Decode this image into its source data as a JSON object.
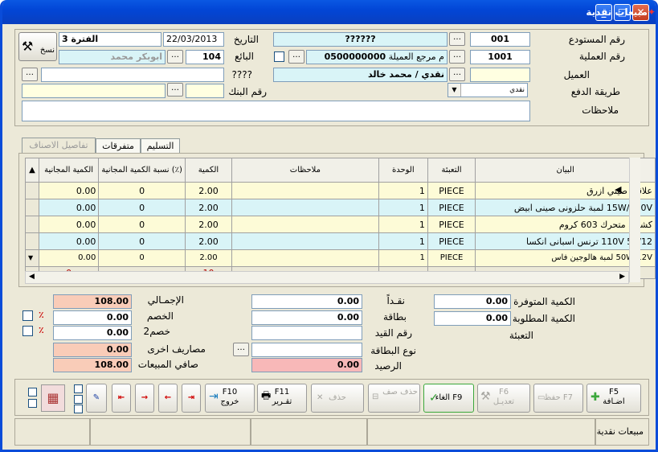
{
  "window": {
    "title": "مبيعات نقدية"
  },
  "header": {
    "labels": {
      "warehouse_no": "رقم المستودع",
      "operation_no": "رقم العملية",
      "client": "العميل",
      "payment_method": "طريقة الدفع",
      "notes": "ملاحظات",
      "date": "التاريخ",
      "seller": "البائع",
      "unknown": "????",
      "bank_no": "رقم البنك"
    },
    "values": {
      "warehouse_no": "001",
      "warehouse_name": "??????",
      "operation_no": "1001",
      "client_ref": "0500000000",
      "client_ref_label": "م مرجع العميلة",
      "client_name": "نقدي / محمد خالد",
      "payment_method": "نقدي",
      "date": "22/03/2013",
      "period": "الفترة 3",
      "seller_no": "104",
      "seller_name": "ابوبكر محمد",
      "copy_button": "نسخ"
    }
  },
  "tabs": [
    "تفاصيل الاصناف",
    "متفرقات",
    "التسليم"
  ],
  "grid": {
    "columns": [
      "البيان",
      "التعبئة",
      "الوحدة",
      "ملاحظات",
      "الكمية",
      "نسبة الكمية المجانية (٪)",
      "الكمية المجانية"
    ],
    "rows": [
      {
        "desc": "علاقي صيني ازرق",
        "pack": "PIECE",
        "unit": "1",
        "notes": "",
        "qty": "2.00",
        "free_pct": "0",
        "free_qty": "0.00"
      },
      {
        "desc": "15W/220V لمبة حلزونى صينى ابيض",
        "pack": "PIECE",
        "unit": "1",
        "notes": "",
        "qty": "2.00",
        "free_pct": "0",
        "free_qty": "0.00"
      },
      {
        "desc": "كشاف متحرك 603 كروم",
        "pack": "PIECE",
        "unit": "1",
        "notes": "",
        "qty": "2.00",
        "free_pct": "0",
        "free_qty": "0.00"
      },
      {
        "desc": "50/12  110V  ترنس اسبانى انكسا",
        "pack": "PIECE",
        "unit": "1",
        "notes": "",
        "qty": "2.00",
        "free_pct": "0",
        "free_qty": "0.00"
      },
      {
        "desc": "50W/12V  لمبة هالوجين فاس",
        "pack": "PIECE",
        "unit": "1",
        "notes": "",
        "qty": "2.00",
        "free_pct": "0",
        "free_qty": "0.00"
      }
    ],
    "totals": {
      "qty": "10",
      "free_qty": "0"
    }
  },
  "summary": {
    "labels": {
      "available_qty": "الكمية المتوفرة",
      "required_qty": "الكمية المطلوبة",
      "packing": "التعبئة",
      "cash": "نقـداً",
      "card": "بطاقة",
      "entry_no": "رقم القيد",
      "card_type": "نوع البطاقة",
      "balance": "الرصيد",
      "total": "الإجمـالي",
      "discount": "الخصم",
      "discount2": "خصم2",
      "other_expenses": "مصاريف اخرى",
      "net_sales": "صافي المبيعات"
    },
    "values": {
      "available_qty": "0.00",
      "required_qty": "0.00",
      "cash": "0.00",
      "card": "0.00",
      "balance": "0.00",
      "total": "108.00",
      "discount": "0.00",
      "discount2": "0.00",
      "other_expenses": "0.00",
      "net_sales": "108.00",
      "pct_mark": "٪"
    }
  },
  "toolbar": {
    "add": {
      "key": "F5",
      "label": "اضـافة"
    },
    "save": {
      "label": "حفظ F7"
    },
    "edit": {
      "key": "F6",
      "label": "تعديـل"
    },
    "cancel": {
      "label": "الغاء F9"
    },
    "delete_row": {
      "label": "حذف صف"
    },
    "delete": {
      "label": "حذف"
    },
    "print": {
      "key": "F11",
      "label": "تقـرير"
    },
    "exit": {
      "key": "F10",
      "label": "خروج"
    }
  },
  "status": {
    "text": "مبيعات نقدية"
  }
}
